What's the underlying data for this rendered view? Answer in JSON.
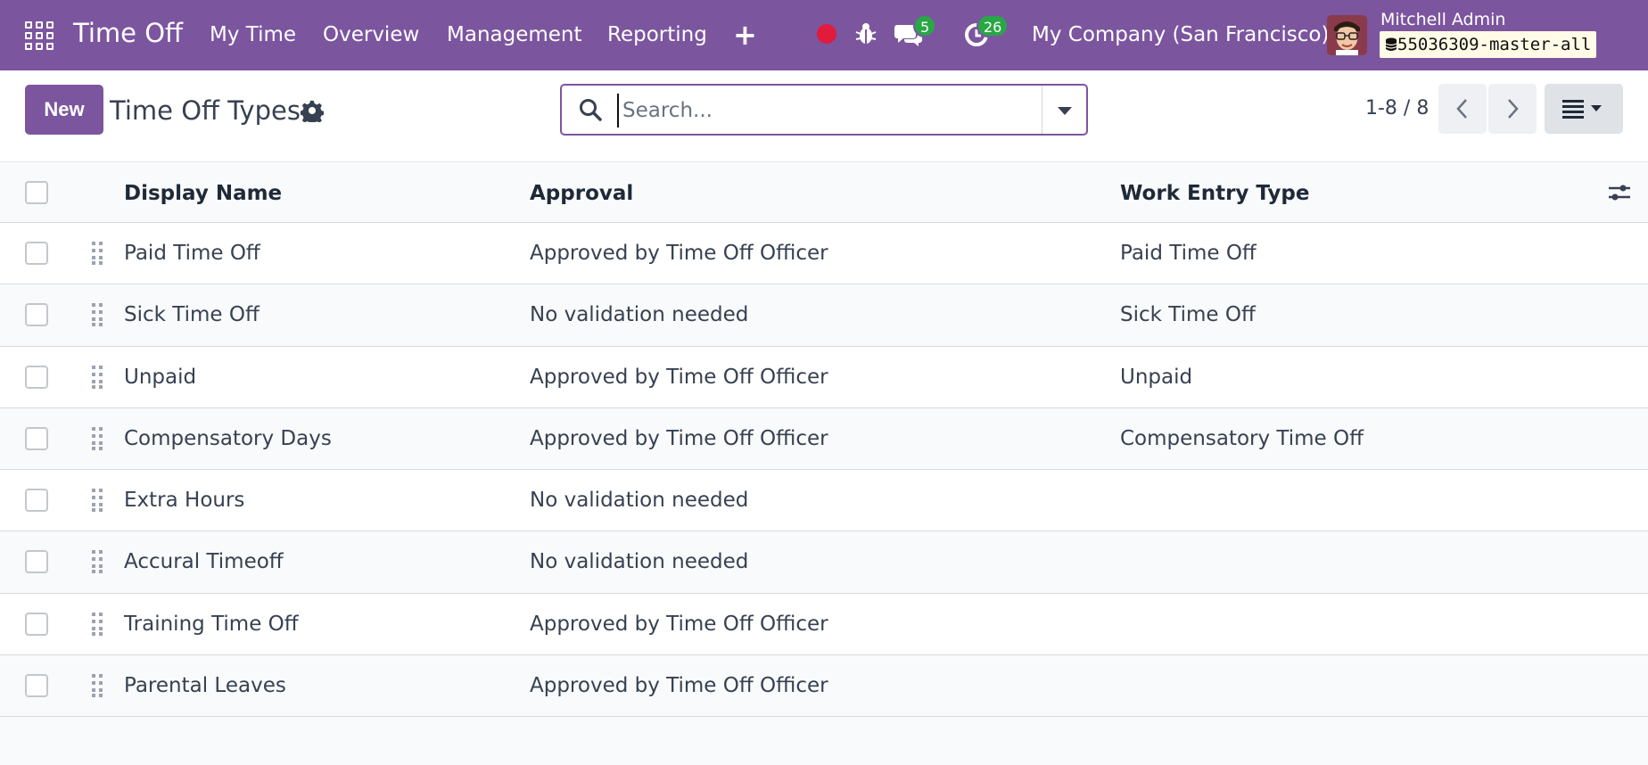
{
  "header": {
    "app_title": "Time Off",
    "nav": [
      "My Time",
      "Overview",
      "Management",
      "Reporting"
    ],
    "plus_label": "+",
    "messages_badge": "5",
    "activities_badge": "26",
    "company": "My Company (San Francisco)",
    "user_name": "Mitchell Admin",
    "database": "55036309-master-all",
    "colors": {
      "brand": "#7c559f",
      "badge": "#28a745",
      "record": "#e01b3c"
    }
  },
  "control": {
    "new_label": "New",
    "page_title": "Time Off Types",
    "search_placeholder": "Search...",
    "pager": "1-8 / 8"
  },
  "table": {
    "columns": [
      "Display Name",
      "Approval",
      "Work Entry Type"
    ],
    "rows": [
      {
        "name": "Paid Time Off",
        "approval": "Approved by Time Off Officer",
        "work_entry": "Paid Time Off"
      },
      {
        "name": "Sick Time Off",
        "approval": "No validation needed",
        "work_entry": "Sick Time Off"
      },
      {
        "name": "Unpaid",
        "approval": "Approved by Time Off Officer",
        "work_entry": "Unpaid"
      },
      {
        "name": "Compensatory Days",
        "approval": "Approved by Time Off Officer",
        "work_entry": "Compensatory Time Off"
      },
      {
        "name": "Extra Hours",
        "approval": "No validation needed",
        "work_entry": ""
      },
      {
        "name": "Accural Timeoff",
        "approval": "No validation needed",
        "work_entry": ""
      },
      {
        "name": "Training Time Off",
        "approval": "Approved by Time Off Officer",
        "work_entry": ""
      },
      {
        "name": "Parental Leaves",
        "approval": "Approved by Time Off Officer",
        "work_entry": ""
      }
    ]
  }
}
